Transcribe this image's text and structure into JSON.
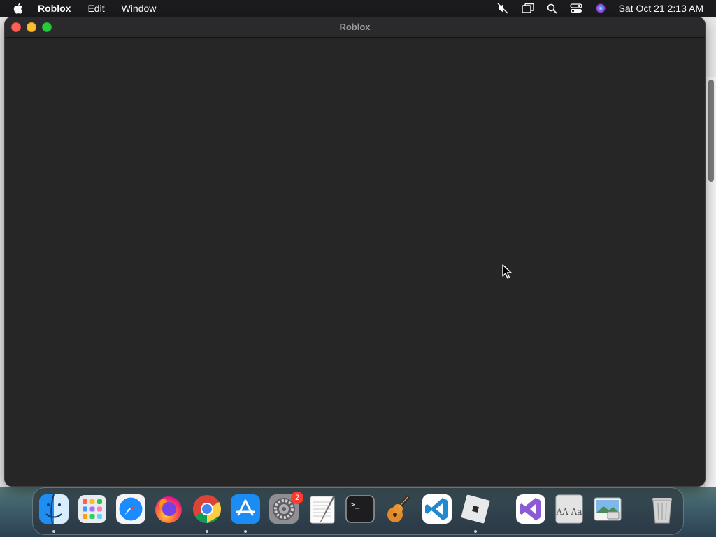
{
  "menubar": {
    "app_name": "Roblox",
    "items": [
      "Edit",
      "Window"
    ],
    "clock": "Sat Oct 21  2:13 AM",
    "status_icons": [
      "mute-icon",
      "screen-mirroring-icon",
      "spotlight-search-icon",
      "control-center-icon",
      "siri-icon"
    ]
  },
  "window": {
    "title": "Roblox"
  },
  "dock": {
    "apps": [
      {
        "name": "Finder",
        "icon": "finder-icon",
        "running": true
      },
      {
        "name": "Launchpad",
        "icon": "launchpad-icon",
        "running": false
      },
      {
        "name": "Safari",
        "icon": "safari-icon",
        "running": false
      },
      {
        "name": "Firefox",
        "icon": "firefox-icon",
        "running": false
      },
      {
        "name": "Google Chrome",
        "icon": "chrome-icon",
        "running": true
      },
      {
        "name": "App Store",
        "icon": "app-store-icon",
        "running": true
      },
      {
        "name": "System Preferences",
        "icon": "system-preferences-icon",
        "running": false,
        "badge": "2"
      },
      {
        "name": "TextEdit",
        "icon": "textedit-icon",
        "running": false
      },
      {
        "name": "Terminal",
        "icon": "terminal-icon",
        "running": false
      },
      {
        "name": "GarageBand",
        "icon": "garageband-icon",
        "running": false
      },
      {
        "name": "Visual Studio Code",
        "icon": "vscode-icon",
        "running": false
      },
      {
        "name": "Roblox",
        "icon": "roblox-icon",
        "running": true
      },
      {
        "name": "Visual Studio",
        "icon": "visual-studio-icon",
        "running": false
      },
      {
        "name": "Font Book",
        "icon": "font-book-icon",
        "running": false
      },
      {
        "name": "Preview",
        "icon": "preview-icon",
        "running": false
      },
      {
        "name": "Trash",
        "icon": "trash-icon",
        "running": false
      }
    ],
    "terminal_prompt": ">_",
    "fontbook_glyphs": "AA Aa"
  },
  "colors": {
    "window_bg": "#262627",
    "menubar_bg": "#1b1b1d",
    "close": "#fe5f57",
    "minimize": "#febc2e",
    "maximize": "#28c840"
  }
}
